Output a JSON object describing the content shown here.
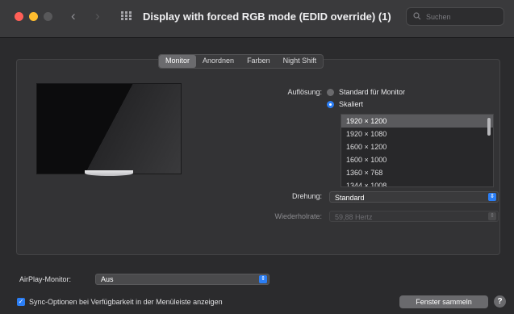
{
  "window": {
    "title": "Display with forced RGB mode (EDID override) (1)",
    "search_placeholder": "Suchen"
  },
  "tabs": [
    {
      "label": "Monitor",
      "active": true
    },
    {
      "label": "Anordnen",
      "active": false
    },
    {
      "label": "Farben",
      "active": false
    },
    {
      "label": "Night Shift",
      "active": false
    }
  ],
  "resolution": {
    "label": "Auflösung:",
    "options": [
      {
        "label": "Standard für Monitor",
        "selected": false
      },
      {
        "label": "Skaliert",
        "selected": true
      }
    ],
    "list": [
      "1920 × 1200",
      "1920 × 1080",
      "1600 × 1200",
      "1600 × 1000",
      "1360 × 768",
      "1344 × 1008"
    ],
    "selected_index": 0
  },
  "rotation": {
    "label": "Drehung:",
    "value": "Standard"
  },
  "refresh": {
    "label": "Wiederholrate:",
    "value": "59,88 Hertz"
  },
  "airplay": {
    "label": "AirPlay-Monitor:",
    "value": "Aus"
  },
  "sync_option": {
    "label": "Sync-Optionen bei Verfügbarkeit in der Menüleiste anzeigen",
    "checked": true
  },
  "buttons": {
    "gather": "Fenster sammeln",
    "help": "?"
  },
  "icons": {
    "back": "chevron-left-icon",
    "forward": "chevron-right-icon",
    "grid": "grid-icon",
    "search": "search-icon"
  },
  "colors": {
    "accent": "#2b7ef5",
    "close": "#ff5f57",
    "minimize": "#febc2e"
  }
}
